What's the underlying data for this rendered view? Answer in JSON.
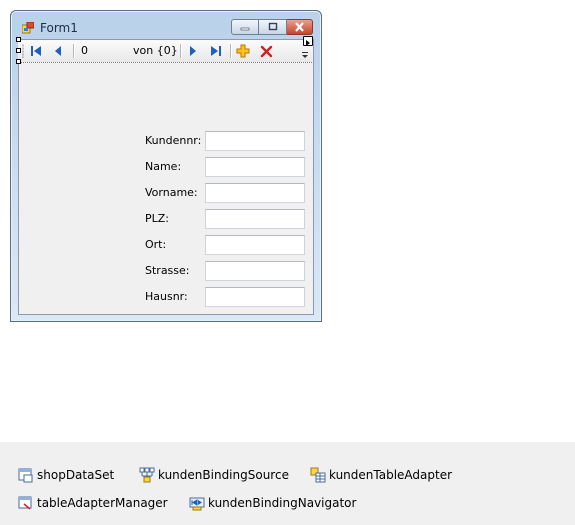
{
  "form": {
    "title": "Form1",
    "icon": "form-icon",
    "caption_buttons": [
      "minimize-icon",
      "maximize-icon",
      "close-icon"
    ]
  },
  "navigator": {
    "position_value": "0",
    "count_label": "von {0}",
    "buttons": [
      "move-first-icon",
      "move-previous-icon",
      "move-next-icon",
      "move-last-icon",
      "add-new-icon",
      "delete-icon"
    ]
  },
  "fields": [
    {
      "label": "Kundennr:",
      "value": ""
    },
    {
      "label": "Name:",
      "value": ""
    },
    {
      "label": "Vorname:",
      "value": ""
    },
    {
      "label": "PLZ:",
      "value": ""
    },
    {
      "label": "Ort:",
      "value": ""
    },
    {
      "label": "Strasse:",
      "value": ""
    },
    {
      "label": "Hausnr:",
      "value": ""
    }
  ],
  "tray": [
    {
      "label": "shopDataSet",
      "icon": "dataset-icon"
    },
    {
      "label": "kundenBindingSource",
      "icon": "binding-source-icon"
    },
    {
      "label": "kundenTableAdapter",
      "icon": "table-adapter-icon"
    },
    {
      "label": "tableAdapterManager",
      "icon": "table-adapter-manager-icon"
    },
    {
      "label": "kundenBindingNavigator",
      "icon": "binding-navigator-icon"
    }
  ],
  "colors": {
    "window_frame": "#b9d1ea",
    "client_background": "#f0f0f0",
    "nav_blue": "#1f5fbf",
    "add_orange": "#e8a000",
    "delete_red": "#d21f1f",
    "tray_background": "#f0f0f0"
  }
}
